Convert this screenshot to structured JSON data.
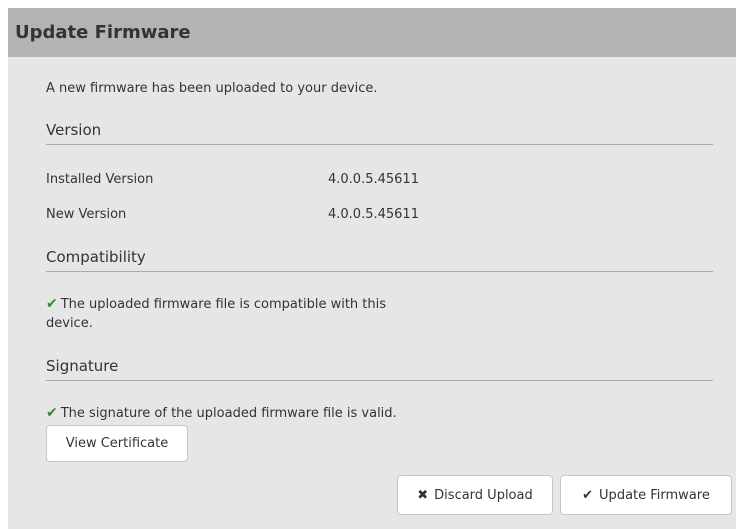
{
  "dialog": {
    "title": "Update Firmware",
    "intro": "A new firmware has been uploaded to your device.",
    "version": {
      "title": "Version",
      "installed_label": "Installed Version",
      "installed_value": "4.0.0.5.45611",
      "new_label": "New Version",
      "new_value": "4.0.0.5.45611"
    },
    "compatibility": {
      "title": "Compatibility",
      "message_line1": "The uploaded firmware file is compatible with this",
      "message_line2": "device."
    },
    "signature": {
      "title": "Signature",
      "message": "The signature of the uploaded firmware file is valid."
    },
    "buttons": {
      "view_certificate": "View Certificate",
      "discard_upload": "Discard Upload",
      "update_firmware": "Update Firmware"
    },
    "icons": {
      "check": "check-icon",
      "close": "close-icon"
    },
    "colors": {
      "header_bg": "#b3b3b3",
      "body_bg": "#e6e6e6",
      "check": "#2e8b2e"
    }
  }
}
